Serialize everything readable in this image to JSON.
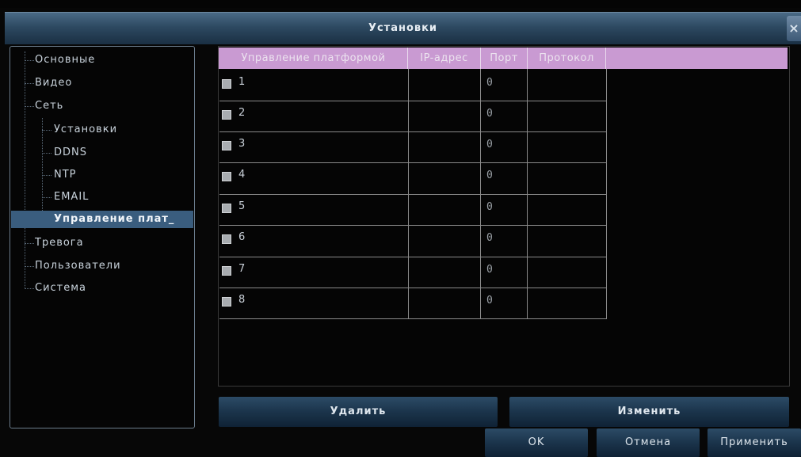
{
  "window": {
    "title": "Установки",
    "close_icon": "×"
  },
  "sidebar": {
    "items": [
      {
        "label": "Основные"
      },
      {
        "label": "Видео"
      },
      {
        "label": "Сеть"
      },
      {
        "label": "Установки"
      },
      {
        "label": "DDNS"
      },
      {
        "label": "NTP"
      },
      {
        "label": "EMAIL"
      },
      {
        "label": "Управление плат_"
      },
      {
        "label": "Тревога"
      },
      {
        "label": "Пользователи"
      },
      {
        "label": "Система"
      }
    ],
    "selected_index": 7
  },
  "table": {
    "columns": [
      "Управление платформой",
      "IP-адрес",
      "Порт",
      "Протокол"
    ],
    "rows": [
      {
        "name": "1",
        "ip": "",
        "port": "0",
        "protocol": "",
        "checked": true
      },
      {
        "name": "2",
        "ip": "",
        "port": "0",
        "protocol": "",
        "checked": true
      },
      {
        "name": "3",
        "ip": "",
        "port": "0",
        "protocol": "",
        "checked": true
      },
      {
        "name": "4",
        "ip": "",
        "port": "0",
        "protocol": "",
        "checked": true
      },
      {
        "name": "5",
        "ip": "",
        "port": "0",
        "protocol": "",
        "checked": true
      },
      {
        "name": "6",
        "ip": "",
        "port": "0",
        "protocol": "",
        "checked": true
      },
      {
        "name": "7",
        "ip": "",
        "port": "0",
        "protocol": "",
        "checked": true
      },
      {
        "name": "8",
        "ip": "",
        "port": "0",
        "protocol": "",
        "checked": true
      }
    ]
  },
  "actions": {
    "delete": "Удалить",
    "edit": "Изменить",
    "ok": "OK",
    "cancel": "Отмена",
    "apply": "Применить"
  },
  "colors": {
    "header_bg": "#c99ad2",
    "title_bar": "#2d4961",
    "selected_bg": "#3a5d7e"
  }
}
